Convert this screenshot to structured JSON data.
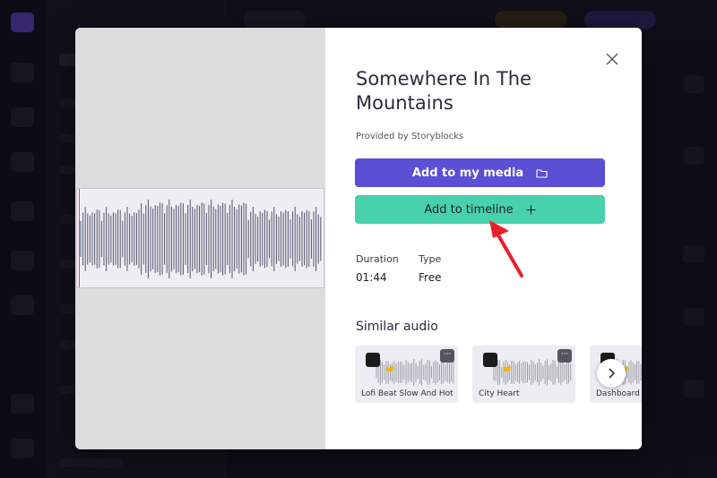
{
  "dialog": {
    "title": "Somewhere In The Mountains",
    "provider": "Provided by Storyblocks",
    "add_media_label": "Add to my media",
    "add_timeline_label": "Add to timeline",
    "close_icon": "close-icon",
    "meta": [
      {
        "label": "Duration",
        "value": "01:44"
      },
      {
        "label": "Type",
        "value": "Free"
      }
    ],
    "similar_title": "Similar audio",
    "similar": [
      {
        "name": "Lofi Beat Slow And Hot"
      },
      {
        "name": "City Heart"
      },
      {
        "name": "Dashboard"
      }
    ]
  },
  "colors": {
    "primary": "#5b4fd6",
    "timeline": "#47d1ad",
    "annotation": "#e8202a",
    "badge": "#f4b400"
  }
}
